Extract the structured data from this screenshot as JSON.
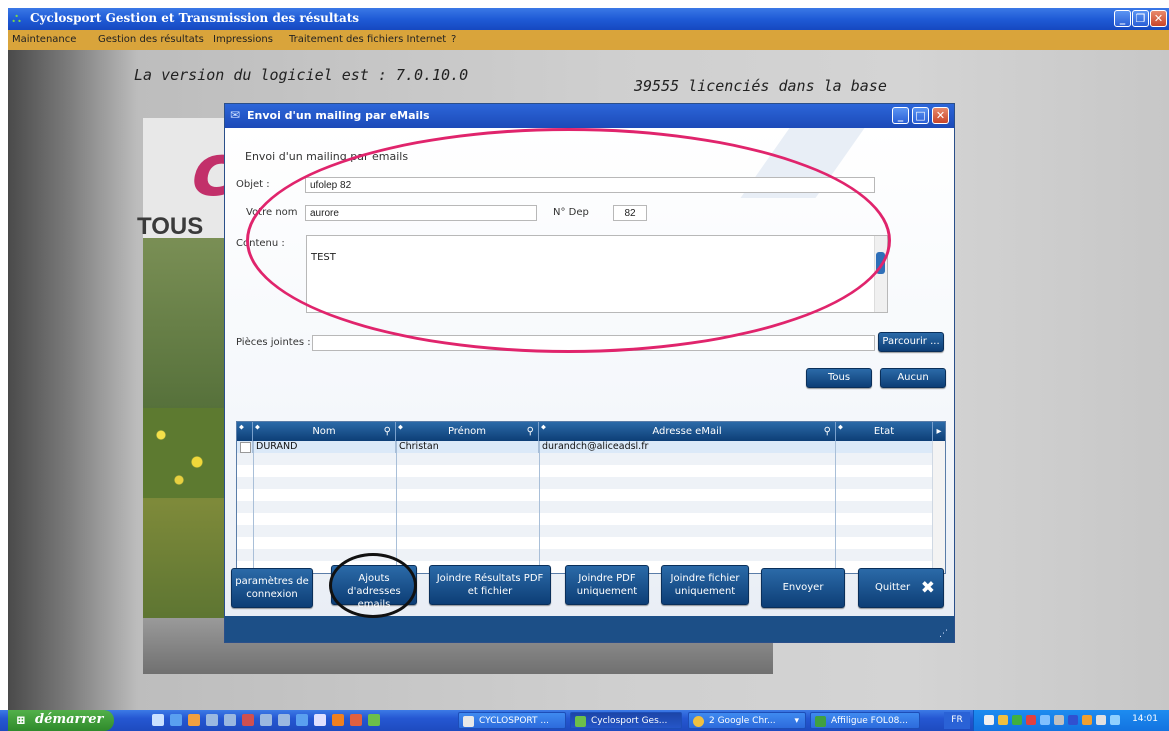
{
  "app": {
    "title": "Cyclosport Gestion et Transmission des résultats",
    "menu": [
      "Maintenance",
      "Gestion des résultats",
      "Impressions",
      "Traitement des fichiers Internet",
      "?"
    ],
    "version_text": "La version  du logiciel est : 7.0.10.0",
    "licencies_text": "39555 licenciés dans la base",
    "bg_word": "TOUS"
  },
  "dialog": {
    "title": "Envoi d'un mailing par eMails",
    "heading": "Envoi d'un mailing par emails",
    "objet_label": "Objet :",
    "objet_value": "ufolep 82",
    "nom_label": "Votre nom",
    "nom_value": "aurore",
    "dep_label": "N° Dep",
    "dep_value": "82",
    "contenu_label": "Contenu :",
    "contenu_value": "TEST",
    "pj_label": "Pièces jointes :",
    "pj_value": "",
    "parcourir": "Parcourir ...",
    "tous": "Tous",
    "aucun": "Aucun",
    "table": {
      "columns": [
        "Nom",
        "Prénom",
        "Adresse eMail",
        "Etat"
      ],
      "rows": [
        {
          "nom": "DURAND",
          "prenom": "Christan",
          "email": "durandch@aliceadsl.fr",
          "etat": ""
        }
      ]
    },
    "buttons": {
      "params": [
        "paramètres de",
        "connexion"
      ],
      "ajouts": [
        "Ajouts d'adresses",
        "emails"
      ],
      "joindre_res": [
        "Joindre Résultats PDF",
        "et fichier"
      ],
      "joindre_pdf": [
        "Joindre PDF",
        "uniquement"
      ],
      "joindre_fichier": [
        "Joindre fichier",
        "uniquement"
      ],
      "envoyer": "Envoyer",
      "quitter": "Quitter",
      "quitter_icon": "✖"
    }
  },
  "taskbar": {
    "start": "démarrer",
    "tasks": [
      "CYCLOSPORT ...",
      "Cyclosport Ges...",
      "2 Google Chr...",
      "Affiligue FOL08..."
    ],
    "lang": "FR",
    "clock": "14:01"
  },
  "colors": {
    "menubar": "#d9a43b",
    "accent_button": "#0d3e76",
    "annotation_pink": "#e0246c",
    "annotation_black": "#111111"
  }
}
